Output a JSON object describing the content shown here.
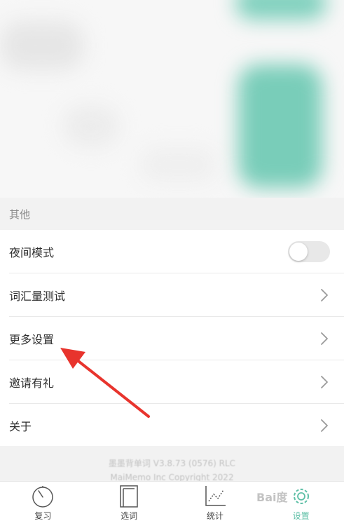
{
  "section": {
    "title": "其他"
  },
  "rows": [
    {
      "label": "夜间模式",
      "control": "toggle",
      "toggle_on": false
    },
    {
      "label": "词汇量测试",
      "control": "chevron"
    },
    {
      "label": "更多设置",
      "control": "chevron"
    },
    {
      "label": "邀请有礼",
      "control": "chevron"
    },
    {
      "label": "关于",
      "control": "chevron"
    }
  ],
  "footer": {
    "version": "墨墨背单词 V3.8.73 (0576) RLC",
    "copyright": "MaiMemo Inc Copyright 2022"
  },
  "tabs": [
    {
      "label": "复习",
      "icon": "timer-icon",
      "active": false
    },
    {
      "label": "选词",
      "icon": "book-icon",
      "active": false
    },
    {
      "label": "统计",
      "icon": "chart-icon",
      "active": false
    },
    {
      "label": "设置",
      "icon": "gear-icon",
      "active": true
    }
  ],
  "watermark": "Bai度",
  "colors": {
    "accent": "#5dbfa6",
    "arrow": "#e8342d",
    "background_gray": "#f2f2f2"
  }
}
